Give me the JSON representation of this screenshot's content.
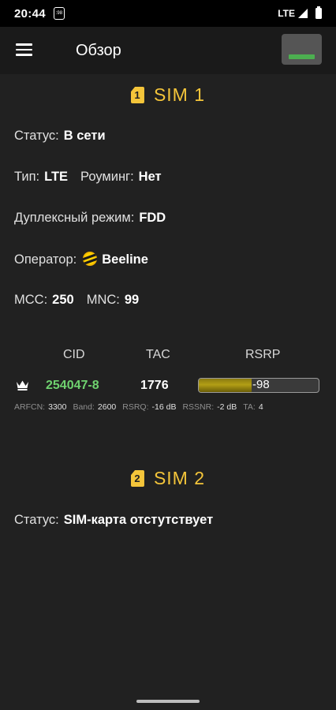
{
  "status_bar": {
    "time": "20:44",
    "notification": ":98",
    "network": "LTE"
  },
  "app_bar": {
    "title": "Обзор"
  },
  "sim1": {
    "badge": "1",
    "title": "SIM 1",
    "status_label": "Статус:",
    "status_value": "В сети",
    "type_label": "Тип:",
    "type_value": "LTE",
    "roaming_label": "Роуминг:",
    "roaming_value": "Нет",
    "duplex_label": "Дуплексный режим:",
    "duplex_value": "FDD",
    "operator_label": "Оператор:",
    "operator_value": "Beeline",
    "mcc_label": "MCC:",
    "mcc_value": "250",
    "mnc_label": "MNC:",
    "mnc_value": "99",
    "cell_table": {
      "headers": {
        "cid": "CID",
        "tac": "TAC",
        "rsrp": "RSRP"
      },
      "row": {
        "cid": "254047-8",
        "tac": "1776",
        "rsrp": "-98",
        "rsrp_level": 0.44,
        "cid_color": "#6fd26f"
      },
      "meta": {
        "arfcn_label": "ARFCN:",
        "arfcn_value": "3300",
        "band_label": "Band:",
        "band_value": "2600",
        "rsrq_label": "RSRQ:",
        "rsrq_value": "-16 dB",
        "rssnr_label": "RSSNR:",
        "rssnr_value": "-2 dB",
        "ta_label": "TA:",
        "ta_value": "4"
      }
    }
  },
  "sim2": {
    "badge": "2",
    "title": "SIM 2",
    "status_label": "Статус:",
    "status_value": "SIM-карта отстутствует"
  },
  "colors": {
    "accent": "#f4c53a",
    "background": "#212121",
    "ok_green": "#4caf50"
  }
}
